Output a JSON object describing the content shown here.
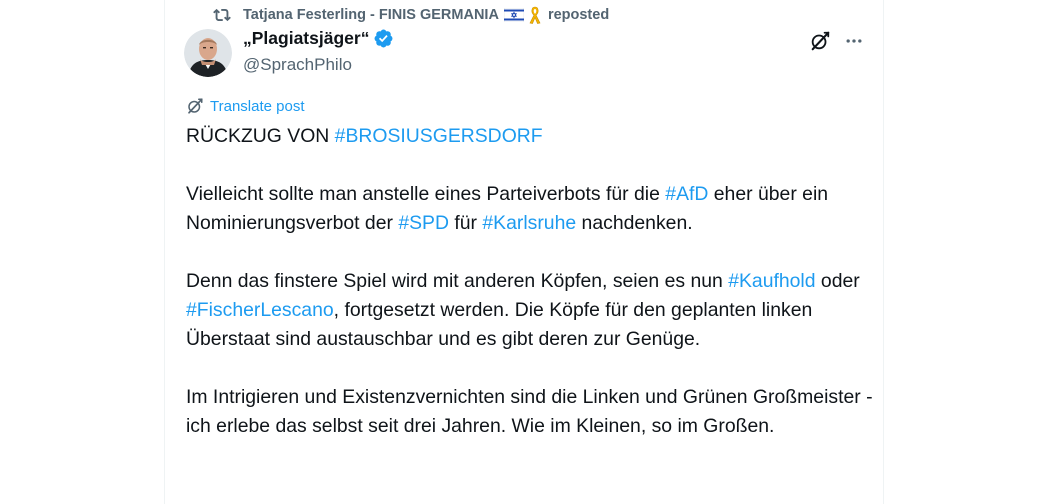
{
  "repost": {
    "name": "Tatjana Festerling - FINIS GERMANIA",
    "suffix": "reposted"
  },
  "author": {
    "display_name": "„Plagiatsjäger“",
    "handle": "@SprachPhilo"
  },
  "translate_label": "Translate post",
  "post": {
    "p1": {
      "t1": "RÜCKZUG VON ",
      "h1": "#BROSIUSGERSDORF"
    },
    "p2": {
      "t1": "Vielleicht sollte man anstelle eines Parteiverbots für die ",
      "h1": "#AfD",
      "t2": " eher über ein Nominierungsverbot der ",
      "h2": "#SPD",
      "t3": " für ",
      "h3": "#Karlsruhe",
      "t4": " nachdenken."
    },
    "p3": {
      "t1": "Denn das finstere Spiel wird mit anderen Köpfen, seien es nun ",
      "h1": "#Kaufhold",
      "t2": " oder ",
      "h2": "#FischerLescano",
      "t3": ", fortgesetzt werden. Die Köpfe für den geplanten linken Überstaat sind austauschbar und es gibt deren zur Genüge."
    },
    "p4": {
      "t1": "Im Intrigieren und Existenzvernichten sind die Linken und Grünen Großmeister - ich erlebe das selbst seit drei Jahren. Wie im Kleinen, so im Großen."
    }
  },
  "icons": {
    "repost": "repost-icon",
    "flag": "israel-flag-icon",
    "ribbon": "yellow-ribbon-icon",
    "verified": "verified-badge-icon",
    "grok": "grok-icon",
    "more": "more-options-icon",
    "translate": "translate-icon"
  },
  "colors": {
    "accent": "#1d9bf0",
    "text": "#0f1419",
    "secondary": "#536471",
    "ribbon": "#f4b400"
  }
}
